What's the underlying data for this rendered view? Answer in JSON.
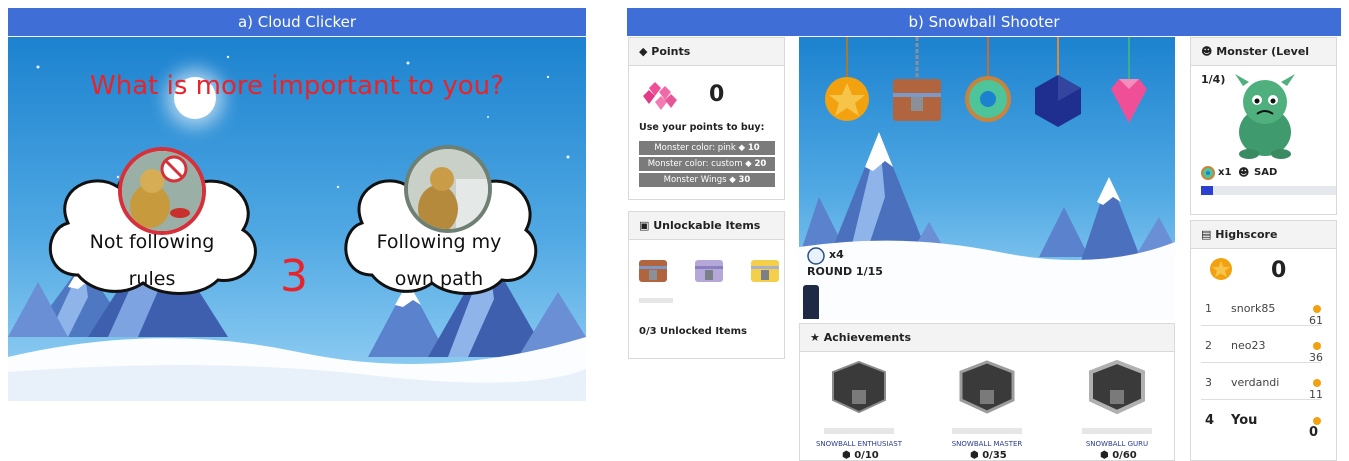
{
  "panel_a": {
    "title": "a) Cloud Clicker",
    "question": "What is more important to you?",
    "left_option": {
      "line1": "Not following",
      "line2": "rules"
    },
    "right_option": {
      "line1": "Following my",
      "line2": "own path"
    },
    "countdown": "3"
  },
  "panel_b": {
    "title": "b) Snowball Shooter",
    "points": {
      "header": "Points",
      "value": "0",
      "buy_label": "Use your points to buy:",
      "items": [
        {
          "label": "Monster color: pink",
          "cost": "10"
        },
        {
          "label": "Monster color: custom",
          "cost": "20"
        },
        {
          "label": "Monster Wings",
          "cost": "30"
        }
      ]
    },
    "unlockables": {
      "header": "Unlockable Items",
      "summary": "0/3 Unlocked Items"
    },
    "game": {
      "snowball_count": "x4",
      "round": "ROUND 1/15"
    },
    "achievements": {
      "header": "Achievements",
      "items": [
        {
          "name": "SNOWBALL ENTHUSIAST",
          "progress": "0/10"
        },
        {
          "name": "SNOWBALL MASTER",
          "progress": "0/35"
        },
        {
          "name": "SNOWBALL GURU",
          "progress": "0/60"
        }
      ]
    },
    "monster": {
      "header": "Monster (Level 1/4)",
      "donut_count": "x1",
      "mood": "SAD",
      "progress": 0.09
    },
    "highscore": {
      "header": "Highscore",
      "current": "0",
      "rows": [
        {
          "rank": "1",
          "name": "snork85",
          "score": "61"
        },
        {
          "rank": "2",
          "name": "neo23",
          "score": "36"
        },
        {
          "rank": "3",
          "name": "verdandi",
          "score": "11"
        },
        {
          "rank": "4",
          "name": "You",
          "score": "0"
        }
      ]
    }
  },
  "colors": {
    "header_blue": "#3f6fd6",
    "question_red": "#e8232a",
    "sky_top": "#1c82cf",
    "coin_orange": "#f2a10f"
  }
}
